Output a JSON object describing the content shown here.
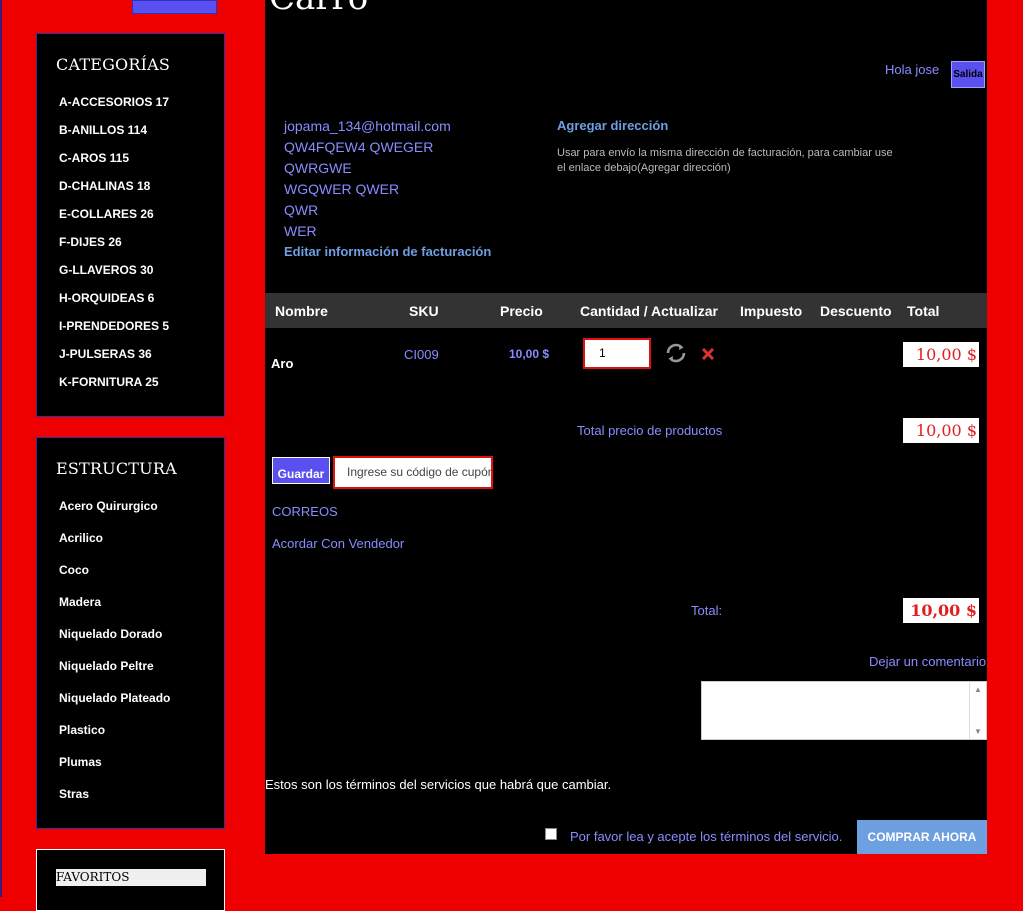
{
  "page": {
    "title": "Carro"
  },
  "sidebar": {
    "categories_title": "CATEGORÍAS",
    "categories": [
      "A-ACCESORIOS 17",
      "B-ANILLOS 114",
      "C-AROS 115",
      "D-CHALINAS 18",
      "E-COLLARES 26",
      "F-DIJES 26",
      "G-LLAVEROS 30",
      "H-ORQUIDEAS 6",
      "I-PRENDEDORES 5",
      "J-PULSERAS 36",
      "K-FORNITURA 25"
    ],
    "structure_title": "ESTRUCTURA",
    "structure": [
      "Acero Quirurgico",
      "Acrilico",
      "Coco",
      "Madera",
      "Niquelado Dorado",
      "Niquelado Peltre",
      "Niquelado Plateado",
      "Plastico",
      "Plumas",
      "Stras"
    ],
    "favorites_label": "FAVORITOS"
  },
  "header": {
    "greeting": "Hola jose",
    "logout_label": "Salida"
  },
  "billing": {
    "lines": [
      "jopama_134@hotmail.com",
      "QW4FQEW4 QWEGER",
      "QWRGWE",
      "WGQWER QWER",
      "QWR",
      "WER"
    ],
    "edit_link": "Editar información de facturación"
  },
  "shipping": {
    "add_address_link": "Agregar dirección",
    "note": "Usar para envío la misma dirección de facturación, para cambiar use el enlace debajo(Agregar dirección)"
  },
  "table": {
    "headers": {
      "name": "Nombre",
      "sku": "SKU",
      "price": "Precio",
      "qty": "Cantidad / Actualizar",
      "tax": "Impuesto",
      "discount": "Descuento",
      "total": "Total"
    },
    "rows": [
      {
        "name": "Aro",
        "sku": "CI009",
        "price": "10,00 $",
        "qty": "1",
        "total": "10,00 $"
      }
    ]
  },
  "summary": {
    "products_total_label": "Total precio de productos",
    "products_total": "10,00 $",
    "total_label": "Total:",
    "total": "10,00 $"
  },
  "coupon": {
    "save_label": "Guardar",
    "placeholder": "Ingrese su código de cupón"
  },
  "shipping_options": [
    "CORREOS",
    "Acordar Con Vendedor"
  ],
  "comment": {
    "label": "Dejar un comentario"
  },
  "terms": {
    "text": "Estos son los términos del servicios que habrá que cambiar.",
    "accept_label": "Por favor lea y acepte los términos del servicio."
  },
  "buy_button_label": "COMPRAR AHORA",
  "colors": {
    "background": "#ee0000",
    "panel": "#000000",
    "link": "#8a8cff",
    "button": "#5a50f0",
    "buy_button": "#6e9fe0",
    "price": "#e02020"
  },
  "icons": {
    "update": "refresh-icon",
    "remove": "close-icon"
  }
}
